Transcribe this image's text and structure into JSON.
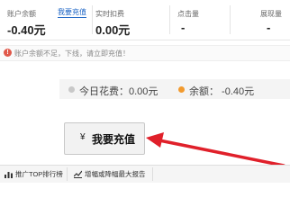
{
  "stats": {
    "account_balance_label": "账户余额",
    "recharge_link": "我要充值",
    "account_balance_value": "-0.40元",
    "realtime_deduction_label": "实时扣费",
    "realtime_deduction_value": "0.00元",
    "clicks_label": "点击量",
    "clicks_value": "-",
    "impressions_label": "展现量",
    "impressions_value": "-"
  },
  "alert": {
    "text": "账户余额不足，下线，请立即充值！"
  },
  "balance": {
    "today_spend": "今日花费：0.00元",
    "remaining": "余额：  -0.40元",
    "spend_dot_color": "#c8c8c8",
    "remaining_dot_color": "#f29a2e"
  },
  "recharge_button": {
    "symbol": "¥",
    "label": "我要充值"
  },
  "arrow": {
    "color": "#e0202a"
  },
  "footer": {
    "tabs": [
      {
        "label": "推广TOP排行榜",
        "icon": "bar-chart-icon"
      },
      {
        "label": "增幅或降幅最大报告",
        "icon": "trend-chart-icon"
      }
    ]
  }
}
